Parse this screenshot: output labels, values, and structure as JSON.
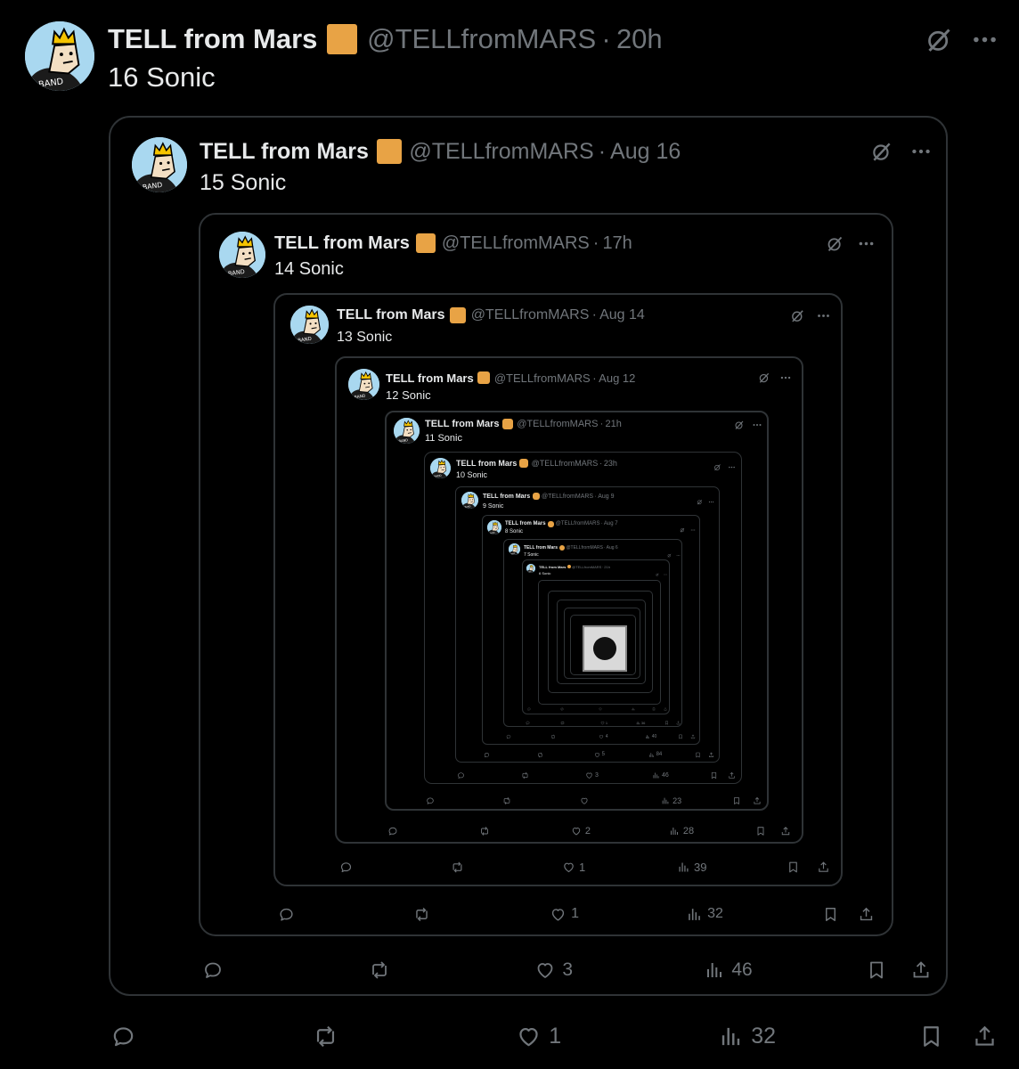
{
  "author": {
    "display_name": "TELL from Mars",
    "handle": "@TELLfromMARS",
    "avatar_text": "BAND"
  },
  "posts": [
    {
      "text": "16 Sonic",
      "time": "20h",
      "replies": "",
      "reposts": "",
      "likes": "1",
      "views": "32"
    },
    {
      "text": "15 Sonic",
      "time": "Aug 16",
      "replies": "",
      "reposts": "",
      "likes": "3",
      "views": "46"
    },
    {
      "text": "14 Sonic",
      "time": "17h",
      "replies": "",
      "reposts": "",
      "likes": "1",
      "views": "32"
    },
    {
      "text": "13 Sonic",
      "time": "Aug 14",
      "replies": "",
      "reposts": "",
      "likes": "1",
      "views": "39"
    },
    {
      "text": "12 Sonic",
      "time": "Aug 12",
      "replies": "",
      "reposts": "",
      "likes": "2",
      "views": "28"
    },
    {
      "text": "11 Sonic",
      "time": "21h",
      "replies": "",
      "reposts": "",
      "likes": "",
      "views": "23"
    },
    {
      "text": "10 Sonic",
      "time": "23h",
      "replies": "",
      "reposts": "",
      "likes": "3",
      "views": "46"
    },
    {
      "text": "9 Sonic",
      "time": "Aug 9",
      "replies": "",
      "reposts": "",
      "likes": "5",
      "views": "84"
    },
    {
      "text": "8 Sonic",
      "time": "Aug 7",
      "replies": "",
      "reposts": "",
      "likes": "4",
      "views": "40"
    },
    {
      "text": "7 Sonic",
      "time": "Aug 6",
      "replies": "",
      "reposts": "",
      "likes": "1",
      "views": "36"
    },
    {
      "text": "6 Sonic",
      "time": "21h",
      "replies": "",
      "reposts": "",
      "likes": "",
      "views": ""
    }
  ],
  "icons": {
    "grok": "grok-icon",
    "more": "more-icon",
    "reply": "reply-icon",
    "repost": "repost-icon",
    "like": "heart-icon",
    "views": "views-icon",
    "bookmark": "bookmark-icon",
    "share": "share-icon"
  },
  "colors": {
    "background": "#000000",
    "border": "#2f3336",
    "muted": "#71767b",
    "text": "#e7e9ea",
    "badge": "#e8a345"
  }
}
